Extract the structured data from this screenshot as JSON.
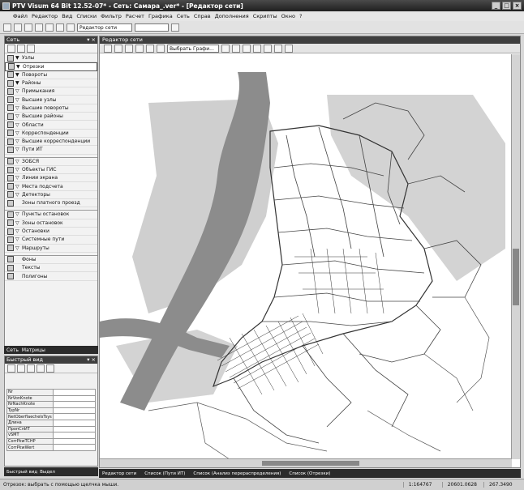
{
  "window": {
    "title": "PTV Visum 64 Bit 12.52-07* - Сеть: Самара_.ver* - [Редактор сети]"
  },
  "menu": [
    "Файл",
    "Редактор",
    "Вид",
    "Списки",
    "Фильтр",
    "Расчет",
    "Графика",
    "Сеть",
    "Справ",
    "Дополнения",
    "Скрипты",
    "Окно",
    "?"
  ],
  "toolbar": {
    "view_combo": "Редактор сети"
  },
  "net_panel": {
    "title": "Сеть",
    "items": [
      "Узлы",
      "Отрезки",
      "Повороты",
      "Районы",
      "Примыкания",
      "Высшие узлы",
      "Высшие повороты",
      "Высшие районы",
      "Области",
      "Корреспонденции",
      "Высшие корреспонденции",
      "Пути ИТ",
      "ЗОБСЯ",
      "Объекты ГИС",
      "Линии экрана",
      "Места подсчета",
      "Детекторы",
      "Зоны платного проезд",
      "Пункты остановок",
      "Зоны остановок",
      "Остановки",
      "Системные пути",
      "Маршруты",
      "Фоны",
      "Тексты",
      "Полигоны"
    ],
    "selected": "Отрезки",
    "tabs": [
      "Сеть",
      "Матрицы"
    ]
  },
  "quick_view": {
    "title": "Быстрый вид",
    "rows": [
      "Nr",
      "NrVonKnote",
      "NrNachKnote",
      "TypNr",
      "NetOberflaecheIsTsys",
      "Длина",
      "ПропСпИТ",
      "vSMT",
      "CorrPkwTCHP",
      "CorrPkwWert"
    ],
    "tabs": [
      "Быстрый вид",
      "Выдел"
    ]
  },
  "editor": {
    "title": "Редактор сети",
    "filter_button": "Выбрать Графи...",
    "tabs": [
      "Редактор сети",
      "Список (Пути ИТ)",
      "Список (Анализ перераспределения)",
      "Список (Отрезки)"
    ]
  },
  "status": {
    "message": "Отрезок: выбрать с помощью щелчка мыши.",
    "scale": "1:164767",
    "x": "20601.0628",
    "y": "267.3490"
  }
}
